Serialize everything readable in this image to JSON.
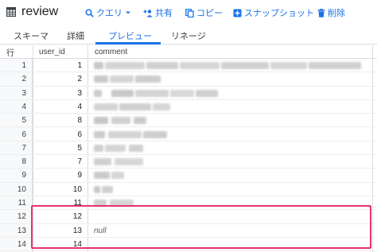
{
  "header": {
    "title": "review",
    "actions": [
      {
        "label": "クエリ",
        "icon": "search-icon"
      },
      {
        "label": "共有",
        "icon": "person-add-icon"
      },
      {
        "label": "コピー",
        "icon": "copy-icon"
      },
      {
        "label": "スナップショット",
        "icon": "snapshot-icon"
      },
      {
        "label": "削除",
        "icon": "trash-icon"
      }
    ]
  },
  "tabs": [
    {
      "label": "スキーマ"
    },
    {
      "label": "詳細"
    },
    {
      "label": "プレビュー",
      "active": true
    },
    {
      "label": "リネージ"
    }
  ],
  "table": {
    "columns": {
      "rownum": "行",
      "user_id": "user_id",
      "comment": "comment"
    },
    "rows": [
      {
        "rownum": "1",
        "user_id": "1",
        "comment": "redacted"
      },
      {
        "rownum": "2",
        "user_id": "2",
        "comment": "redacted"
      },
      {
        "rownum": "3",
        "user_id": "3",
        "comment": "redacted"
      },
      {
        "rownum": "4",
        "user_id": "4",
        "comment": "redacted"
      },
      {
        "rownum": "5",
        "user_id": "8",
        "comment": "redacted"
      },
      {
        "rownum": "6",
        "user_id": "6",
        "comment": "redacted"
      },
      {
        "rownum": "7",
        "user_id": "5",
        "comment": "redacted"
      },
      {
        "rownum": "8",
        "user_id": "7",
        "comment": "redacted"
      },
      {
        "rownum": "9",
        "user_id": "9",
        "comment": "redacted"
      },
      {
        "rownum": "10",
        "user_id": "10",
        "comment": "redacted"
      },
      {
        "rownum": "11",
        "user_id": "11",
        "comment": "redacted"
      },
      {
        "rownum": "12",
        "user_id": "12",
        "comment": ""
      },
      {
        "rownum": "13",
        "user_id": "13",
        "comment": "null"
      },
      {
        "rownum": "14",
        "user_id": "14",
        "comment": ""
      }
    ]
  },
  "colors": {
    "accent": "#1a73e8",
    "highlight": "#e8336e"
  }
}
